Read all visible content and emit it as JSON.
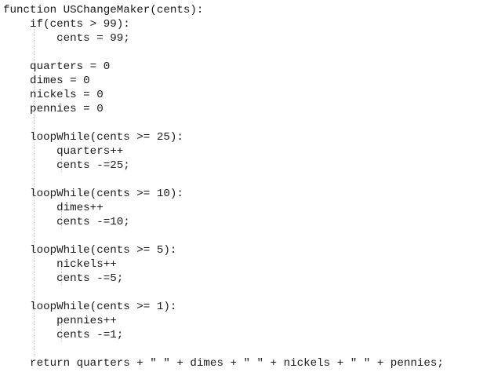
{
  "code": {
    "lines": [
      "function USChangeMaker(cents):",
      "    if(cents > 99):",
      "        cents = 99;",
      "",
      "    quarters = 0",
      "    dimes = 0",
      "    nickels = 0",
      "    pennies = 0",
      "",
      "    loopWhile(cents >= 25):",
      "        quarters++",
      "        cents -=25;",
      "",
      "    loopWhile(cents >= 10):",
      "        dimes++",
      "        cents -=10;",
      "",
      "    loopWhile(cents >= 5):",
      "        nickels++",
      "        cents -=5;",
      "",
      "    loopWhile(cents >= 1):",
      "        pennies++",
      "        cents -=1;",
      "",
      "    return quarters + \" \" + dimes + \" \" + nickels + \" \" + pennies;"
    ]
  },
  "colors": {
    "text": "#1a1a1a",
    "background": "#ffffff",
    "indent_guide": "#c8c8c8"
  }
}
